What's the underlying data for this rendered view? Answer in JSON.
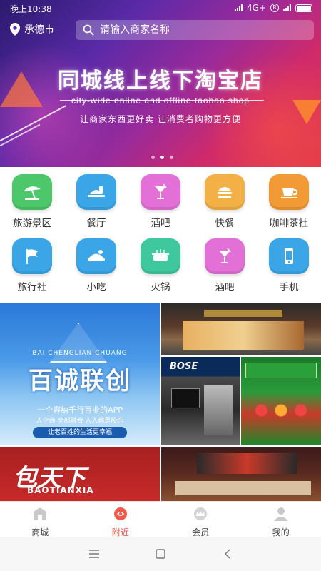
{
  "status_bar": {
    "time": "晚上10:38",
    "network": "4G+"
  },
  "header": {
    "city": "承德市",
    "search_placeholder": "请输入商家名称"
  },
  "banner": {
    "title": "同城线上线下淘宝店",
    "subtitle": "city-wide online and offline taobao shop",
    "slogan": "让商家东西更好卖 让消费者购物更方便"
  },
  "categories": [
    {
      "label": "旅游景区",
      "icon": "beach-umbrella-icon",
      "color": "#4cc86a"
    },
    {
      "label": "餐厅",
      "icon": "food-tray-icon",
      "color": "#3aa6e8"
    },
    {
      "label": "酒吧",
      "icon": "cocktail-icon",
      "color": "#e270d6"
    },
    {
      "label": "快餐",
      "icon": "burger-icon",
      "color": "#f2b046"
    },
    {
      "label": "咖啡茶社",
      "icon": "coffee-cup-icon",
      "color": "#f29a36"
    },
    {
      "label": "旅行社",
      "icon": "flag-icon",
      "color": "#3aa6e8"
    },
    {
      "label": "小吃",
      "icon": "snack-icon",
      "color": "#3aa6e8"
    },
    {
      "label": "火锅",
      "icon": "hotpot-icon",
      "color": "#3fc89e"
    },
    {
      "label": "酒吧",
      "icon": "cocktail-icon",
      "color": "#e270d6"
    },
    {
      "label": "手机",
      "icon": "phone-icon",
      "color": "#3aa6e8"
    }
  ],
  "photos": {
    "promo": {
      "pinyin": "BAI CHENGLIAN CHUANG",
      "title": "百诚联创",
      "line1": "一个容纳千行百业的APP",
      "line2": "人企商 全部融合 人人都是股东",
      "pill": "让老百姓的生活更幸福"
    },
    "bose_logo": "BOSE",
    "brand": {
      "name": "包天下",
      "en": "BAOTIANXIA"
    }
  },
  "tabs": [
    {
      "label": "商城",
      "icon": "shop-icon",
      "active": false
    },
    {
      "label": "附近",
      "icon": "nearby-icon",
      "active": true
    },
    {
      "label": "会员",
      "icon": "crown-icon",
      "active": false
    },
    {
      "label": "我的",
      "icon": "user-icon",
      "active": false
    }
  ],
  "colors": {
    "accent": "#f2594b",
    "search_bg": "rgba(255,255,255,0.25)"
  }
}
